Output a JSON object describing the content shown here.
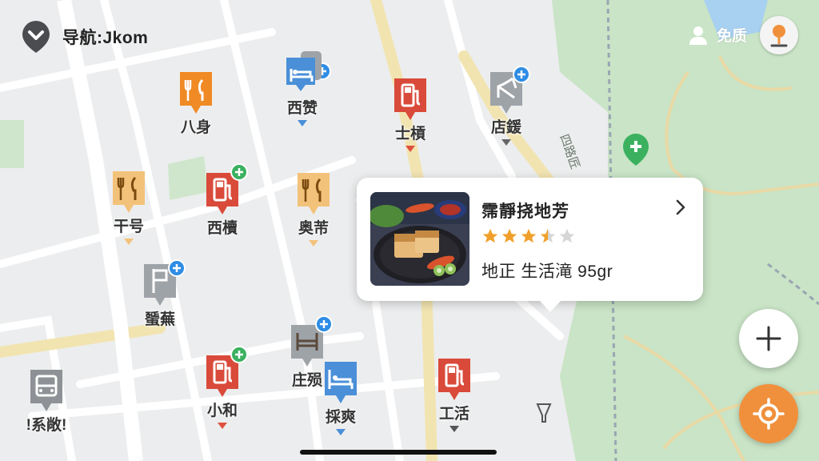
{
  "header": {
    "title": "导航:Jkom",
    "user_label": "免质"
  },
  "colors": {
    "accent": "#f0903c",
    "food": "#f08a24",
    "food_light": "#f3c27a",
    "hotel": "#4a8fd8",
    "gas": "#d94a3a",
    "gray": "#8e9296",
    "park": "#c8e3c4"
  },
  "pois": [
    {
      "label": "八身",
      "icon": "restaurant-icon",
      "kind": "food",
      "triangle": false
    },
    {
      "label": "西赞",
      "icon": "hotel-icon",
      "kind": "hotel",
      "triangle": true
    },
    {
      "label": "士槓",
      "icon": "gas-station-icon",
      "kind": "gas",
      "triangle": true
    },
    {
      "label": "店鍰",
      "icon": "airport-icon",
      "kind": "gray",
      "triangle": true
    },
    {
      "label": "干号",
      "icon": "restaurant-icon",
      "kind": "food_light",
      "triangle": true
    },
    {
      "label": "西櫝",
      "icon": "gas-station-icon",
      "kind": "gas",
      "triangle": false
    },
    {
      "label": "奥芾",
      "icon": "restaurant-icon",
      "kind": "food_light",
      "triangle": true
    },
    {
      "label": "蜑蕪",
      "icon": "flag-icon",
      "kind": "gray",
      "triangle": false
    },
    {
      "label": "!系敞!",
      "icon": "bus-icon",
      "kind": "gray",
      "triangle": false
    },
    {
      "label": "小和",
      "icon": "gas-station-icon",
      "kind": "gas",
      "triangle": true
    },
    {
      "label": "庄殒",
      "icon": "bed-icon",
      "kind": "gray",
      "triangle": false
    },
    {
      "label": "採爽",
      "icon": "hotel-icon",
      "kind": "hotel",
      "triangle": true
    },
    {
      "label": "工活",
      "icon": "gas-station-icon",
      "kind": "gas",
      "triangle": true
    }
  ],
  "road_label": "四路匠",
  "place_card": {
    "name": "霈靜挠地芳",
    "rating": 3.5,
    "rating_max": 5,
    "meta": "地正 生活滝 95gr",
    "photo": "food-photo"
  },
  "controls": {
    "zoom_in_icon": "plus-icon",
    "locate_icon": "locate-icon"
  }
}
